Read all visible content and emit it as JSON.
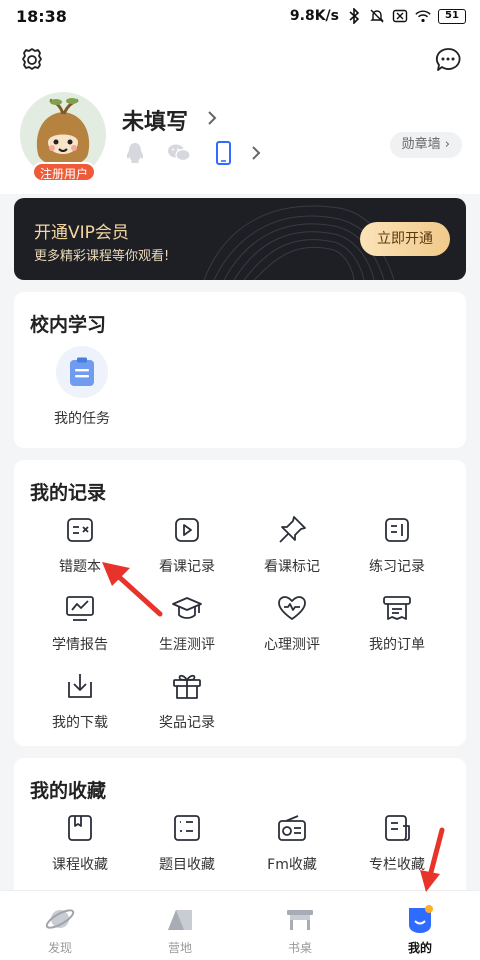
{
  "status_bar": {
    "time": "18:38",
    "net_speed": "9.8K/s",
    "battery": "51",
    "icons": [
      "bluetooth-icon",
      "mute-bell-icon",
      "sim-off-icon",
      "wifi-icon",
      "battery-icon"
    ]
  },
  "header": {
    "settings_icon": "gear-icon",
    "message_icon": "chat-bubble-icon",
    "user_badge": "注册用户",
    "username": "未填写",
    "socials": [
      "qq-icon",
      "wechat-icon",
      "phone-icon"
    ],
    "medal_wall": "勋章墙"
  },
  "vip": {
    "title": "开通VIP会员",
    "subtitle": "更多精彩课程等你观看!",
    "button": "立即开通"
  },
  "campus": {
    "title": "校内学习",
    "items": [
      {
        "label": "我的任务",
        "icon": "clipboard-icon"
      }
    ]
  },
  "records": {
    "title": "我的记录",
    "items": [
      {
        "label": "错题本",
        "icon": "wrong-book-icon"
      },
      {
        "label": "看课记录",
        "icon": "video-play-icon"
      },
      {
        "label": "看课标记",
        "icon": "pin-icon"
      },
      {
        "label": "练习记录",
        "icon": "practice-icon"
      },
      {
        "label": "学情报告",
        "icon": "report-chart-icon"
      },
      {
        "label": "生涯测评",
        "icon": "graduation-cap-icon"
      },
      {
        "label": "心理测评",
        "icon": "heart-pulse-icon"
      },
      {
        "label": "我的订单",
        "icon": "receipt-icon"
      },
      {
        "label": "我的下载",
        "icon": "download-icon"
      },
      {
        "label": "奖品记录",
        "icon": "gift-icon"
      }
    ]
  },
  "favorites": {
    "title": "我的收藏",
    "items": [
      {
        "label": "课程收藏",
        "icon": "course-bookmark-icon"
      },
      {
        "label": "题目收藏",
        "icon": "question-list-icon"
      },
      {
        "label": "Fm收藏",
        "icon": "radio-icon"
      },
      {
        "label": "专栏收藏",
        "icon": "column-doc-icon"
      }
    ]
  },
  "bottom_nav": {
    "items": [
      {
        "label": "发现",
        "icon": "planet-icon",
        "active": false
      },
      {
        "label": "营地",
        "icon": "tent-icon",
        "active": false
      },
      {
        "label": "书桌",
        "icon": "desk-icon",
        "active": false
      },
      {
        "label": "我的",
        "icon": "profile-mascot-icon",
        "active": true
      }
    ]
  },
  "colors": {
    "accent_red": "#ef5b38",
    "vip_gold": "#f3d6a2",
    "vip_bg": "#1e1f24",
    "icon_stroke": "#2c2f3a",
    "nav_active_blue": "#2f6bff"
  }
}
